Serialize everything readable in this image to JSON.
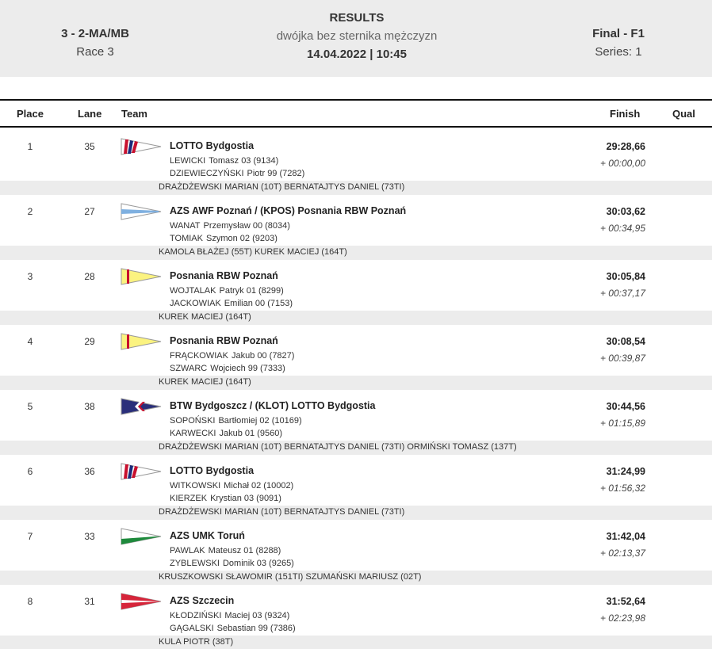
{
  "header": {
    "category": "3 - 2-MA/MB",
    "race": "Race 3",
    "title": "RESULTS",
    "event_name": "dwójka bez sternika mężczyzn",
    "datetime": "14.04.2022 | 10:45",
    "phase": "Final - F1",
    "series": "Series: 1"
  },
  "columns": {
    "place": "Place",
    "lane": "Lane",
    "team": "Team",
    "finish": "Finish",
    "qual": "Qual"
  },
  "rows": [
    {
      "place": "1",
      "lane": "35",
      "flag": "lotto",
      "team": "LOTTO Bydgostia",
      "rower1_surname": "LEWICKI",
      "rower1_name": "Tomasz 03 (9134)",
      "rower2_surname": "DZIEWIECZYŃSKI",
      "rower2_name": "Piotr 99 (7282)",
      "finish": "29:28,66",
      "diff": "+ 00:00,00",
      "coaches": "DRAŻDŻEWSKI MARIAN (10T) BERNATAJTYS DANIEL (73TI)"
    },
    {
      "place": "2",
      "lane": "27",
      "flag": "azs-awf",
      "team": "AZS AWF Poznań / (KPOS) Posnania RBW Poznań",
      "rower1_surname": "WANAT",
      "rower1_name": "Przemysław 00 (8034)",
      "rower2_surname": "TOMIAK",
      "rower2_name": "Szymon 02 (9203)",
      "finish": "30:03,62",
      "diff": "+ 00:34,95",
      "coaches": "KAMOLA BŁAŻEJ (55T) KUREK MACIEJ (164T)"
    },
    {
      "place": "3",
      "lane": "28",
      "flag": "posnania",
      "team": "Posnania RBW Poznań",
      "rower1_surname": "WOJTALAK",
      "rower1_name": "Patryk 01 (8299)",
      "rower2_surname": "JACKOWIAK",
      "rower2_name": "Emilian 00 (7153)",
      "finish": "30:05,84",
      "diff": "+ 00:37,17",
      "coaches": "KUREK MACIEJ (164T)"
    },
    {
      "place": "4",
      "lane": "29",
      "flag": "posnania",
      "team": "Posnania RBW Poznań",
      "rower1_surname": "FRĄCKOWIAK",
      "rower1_name": "Jakub 00 (7827)",
      "rower2_surname": "SZWARC",
      "rower2_name": "Wojciech 99 (7333)",
      "finish": "30:08,54",
      "diff": "+ 00:39,87",
      "coaches": "KUREK MACIEJ (164T)"
    },
    {
      "place": "5",
      "lane": "38",
      "flag": "btw",
      "team": "BTW Bydgoszcz / (KLOT) LOTTO Bydgostia",
      "rower1_surname": "SOPOŃSKI",
      "rower1_name": "Bartłomiej 02 (10169)",
      "rower2_surname": "KARWECKI",
      "rower2_name": "Jakub 01 (9560)",
      "finish": "30:44,56",
      "diff": "+ 01:15,89",
      "coaches": "DRAŻDŻEWSKI MARIAN (10T) BERNATAJTYS DANIEL (73TI) ORMIŃSKI TOMASZ (137T)"
    },
    {
      "place": "6",
      "lane": "36",
      "flag": "lotto",
      "team": "LOTTO Bydgostia",
      "rower1_surname": "WITKOWSKI",
      "rower1_name": "Michał 02 (10002)",
      "rower2_surname": "KIERZEK",
      "rower2_name": "Krystian 03 (9091)",
      "finish": "31:24,99",
      "diff": "+ 01:56,32",
      "coaches": "DRAŻDŻEWSKI MARIAN (10T) BERNATAJTYS DANIEL (73TI)"
    },
    {
      "place": "7",
      "lane": "33",
      "flag": "azs-umk",
      "team": "AZS UMK Toruń",
      "rower1_surname": "PAWLAK",
      "rower1_name": "Mateusz 01 (8288)",
      "rower2_surname": "ZYBLEWSKI",
      "rower2_name": "Dominik 03 (9265)",
      "finish": "31:42,04",
      "diff": "+ 02:13,37",
      "coaches": "KRUSZKOWSKI SŁAWOMIR (151TI) SZUMAŃSKI MARIUSZ (02T)"
    },
    {
      "place": "8",
      "lane": "31",
      "flag": "azs-szczecin",
      "team": "AZS Szczecin",
      "rower1_surname": "KŁODZIŃSKI",
      "rower1_name": "Maciej 03 (9324)",
      "rower2_surname": "GĄGALSKI",
      "rower2_name": "Sebastian 99 (7386)",
      "finish": "31:52,64",
      "diff": "+ 02:23,98",
      "coaches": "KULA PIOTR (38T)"
    }
  ],
  "colors": {
    "header_bg": "#ececec",
    "coach_bg": "#ececec",
    "rule": "#111111"
  }
}
